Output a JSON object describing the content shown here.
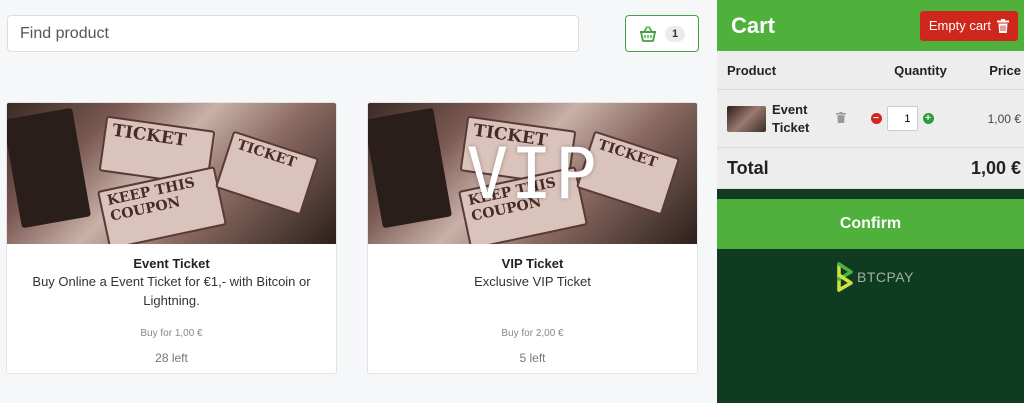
{
  "search": {
    "placeholder": "Find product"
  },
  "cart_button": {
    "count": "1",
    "icon": "basket-icon"
  },
  "products": [
    {
      "title": "Event Ticket",
      "description": "Buy Online a Event Ticket for €1,- with Bitcoin or Lightning.",
      "buy_label": "Buy for 1,00 €",
      "stock": "28 left",
      "overlay": ""
    },
    {
      "title": "VIP Ticket",
      "description": "Exclusive VIP Ticket",
      "buy_label": "Buy for 2,00 €",
      "stock": "5 left",
      "overlay": "VIP"
    }
  ],
  "cart": {
    "title": "Cart",
    "empty_label": "Empty cart",
    "headers": {
      "product": "Product",
      "quantity": "Quantity",
      "price": "Price"
    },
    "items": [
      {
        "name": "Event Ticket",
        "quantity": "1",
        "price": "1,00 €"
      }
    ],
    "total_label": "Total",
    "total_value": "1,00 €",
    "confirm_label": "Confirm",
    "brand": "BTCPAY"
  },
  "colors": {
    "accent_green": "#4fb13b",
    "danger_red": "#d0271d",
    "sidebar_dark": "#0f3b22"
  }
}
